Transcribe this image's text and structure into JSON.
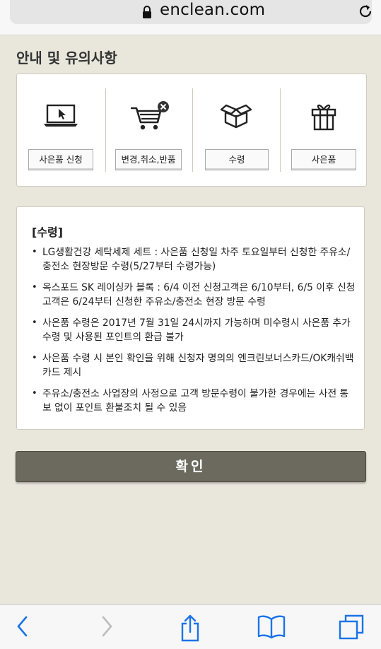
{
  "browser": {
    "url": "enclean.com",
    "lock_icon": "lock-icon",
    "reload_icon": "reload-icon"
  },
  "page": {
    "section_title": "안내 및 유의사항",
    "menu": [
      {
        "icon": "monitor-cursor-icon",
        "label": "사은품 신청"
      },
      {
        "icon": "cart-remove-icon",
        "label": "변경,취소,반품"
      },
      {
        "icon": "open-box-icon",
        "label": "수령"
      },
      {
        "icon": "gift-icon",
        "label": "사은품"
      }
    ],
    "notice": {
      "heading": "[수령]",
      "bullet": "•",
      "items": [
        {
          "text": "LG생활건강 세탁세제 세트 : 사은품 신청일 차주 토요일부터 신청한 주유소/충전소 현장방문 수령(5/27부터 수령가능)"
        },
        {
          "text": "옥스포드 SK 레이싱카 블록 : 6/4 이전 신청고객은 6/10부터, 6/5 이후 신청고객은 6/24부터 신청한 주유소/충전소 현장 방문 수령"
        },
        {
          "text": "사은품 수령은 2017년 7월 31일 24시까지 가능하며 미수령시 사은품 추가 수령 및 사용된 포인트의 환급 불가"
        },
        {
          "text": "사은품 수령 시 본인 확인을 위해 신청자 명의의 엔크린보너스카드/OK캐쉬백카드 제시"
        },
        {
          "text": "주유소/충전소 사업장의 사정으로 고객 방문수령이 불가한 경우에는 사전 통보 없이 포인트 환불조치 될 수 있음"
        }
      ]
    },
    "confirm_label": "확인"
  },
  "toolbar": {
    "back_icon": "back-chevron-icon",
    "forward_icon": "forward-chevron-icon",
    "share_icon": "share-icon",
    "bookmarks_icon": "bookmarks-icon",
    "tabs_icon": "tabs-icon"
  },
  "colors": {
    "background": "#e9e6dc",
    "button": "#6c6a5e",
    "accent_x": "#333333"
  }
}
